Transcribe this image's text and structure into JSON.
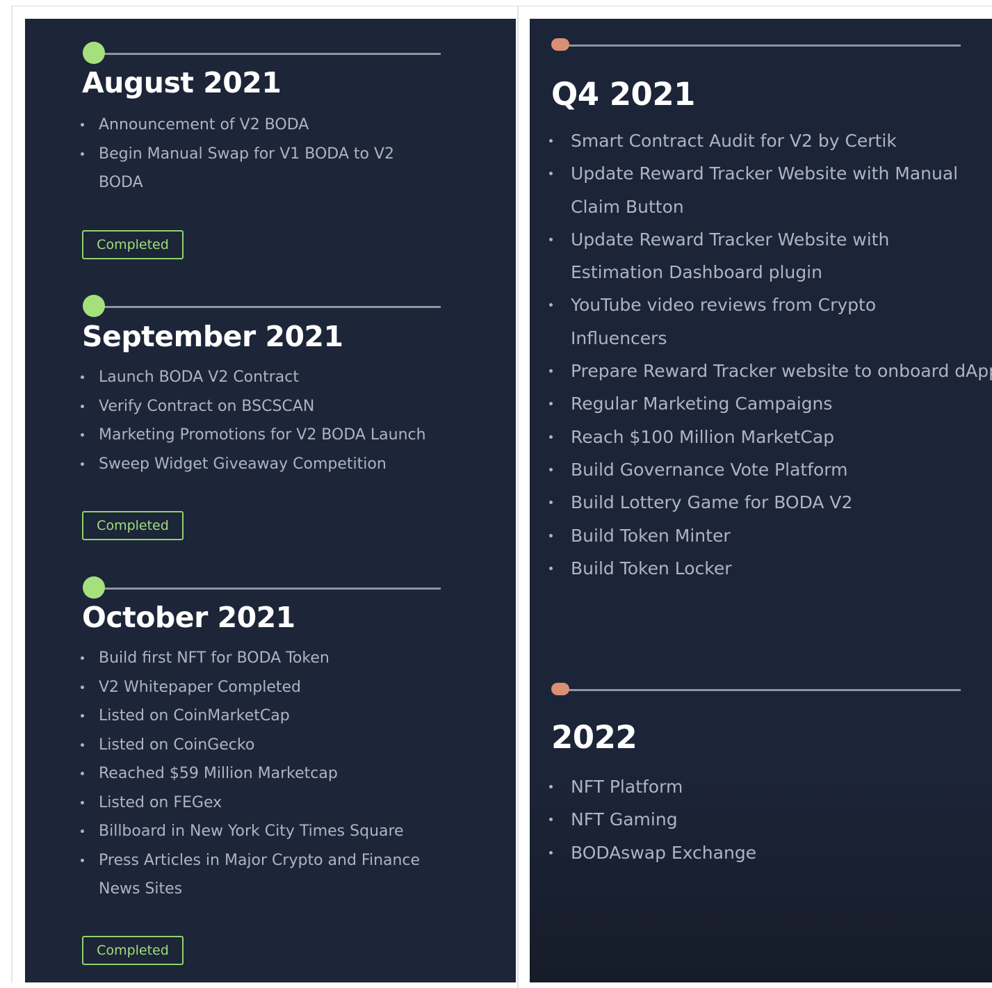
{
  "left_panel": {
    "sections": [
      {
        "title": "August 2021",
        "items": [
          "Announcement of V2 BODA",
          "Begin Manual Swap for V1 BODA to V2 BODA"
        ],
        "status": "Completed"
      },
      {
        "title": "September 2021",
        "items": [
          "Launch BODA V2 Contract",
          "Verify Contract on BSCSCAN",
          "Marketing Promotions for V2 BODA Launch",
          "Sweep Widget Giveaway Competition"
        ],
        "status": "Completed"
      },
      {
        "title": "October 2021",
        "items": [
          "Build first NFT for BODA Token",
          "V2 Whitepaper Completed",
          "Listed on CoinMarketCap",
          "Listed on CoinGecko",
          "Reached $59 Million Marketcap",
          "Listed on FEGex",
          "Billboard in New York City Times Square",
          "Press Articles in Major Crypto and Finance News Sites"
        ],
        "status": "Completed"
      }
    ]
  },
  "right_panel": {
    "sections": [
      {
        "title": "Q4 2021",
        "items": [
          "Smart Contract Audit for V2 by Certik",
          "Update Reward Tracker Website with Manual Claim Button",
          "Update Reward Tracker Website with Estimation Dashboard plugin",
          "YouTube video reviews from Crypto Influencers",
          "Prepare Reward Tracker website to onboard dApps",
          "Regular Marketing Campaigns",
          "Reach $100 Million MarketCap",
          "Build Governance Vote Platform",
          "Build Lottery Game for BODA V2",
          "Build Token Minter",
          "Build Token Locker"
        ]
      },
      {
        "title": "2022",
        "items": [
          "NFT Platform",
          "NFT Gaming",
          "BODAswap Exchange"
        ]
      }
    ]
  },
  "colors": {
    "panel_bg": "#1d2538",
    "completed_accent": "#a6e07c",
    "upcoming_accent": "#d98f74",
    "text_muted": "#aeb4c0"
  }
}
